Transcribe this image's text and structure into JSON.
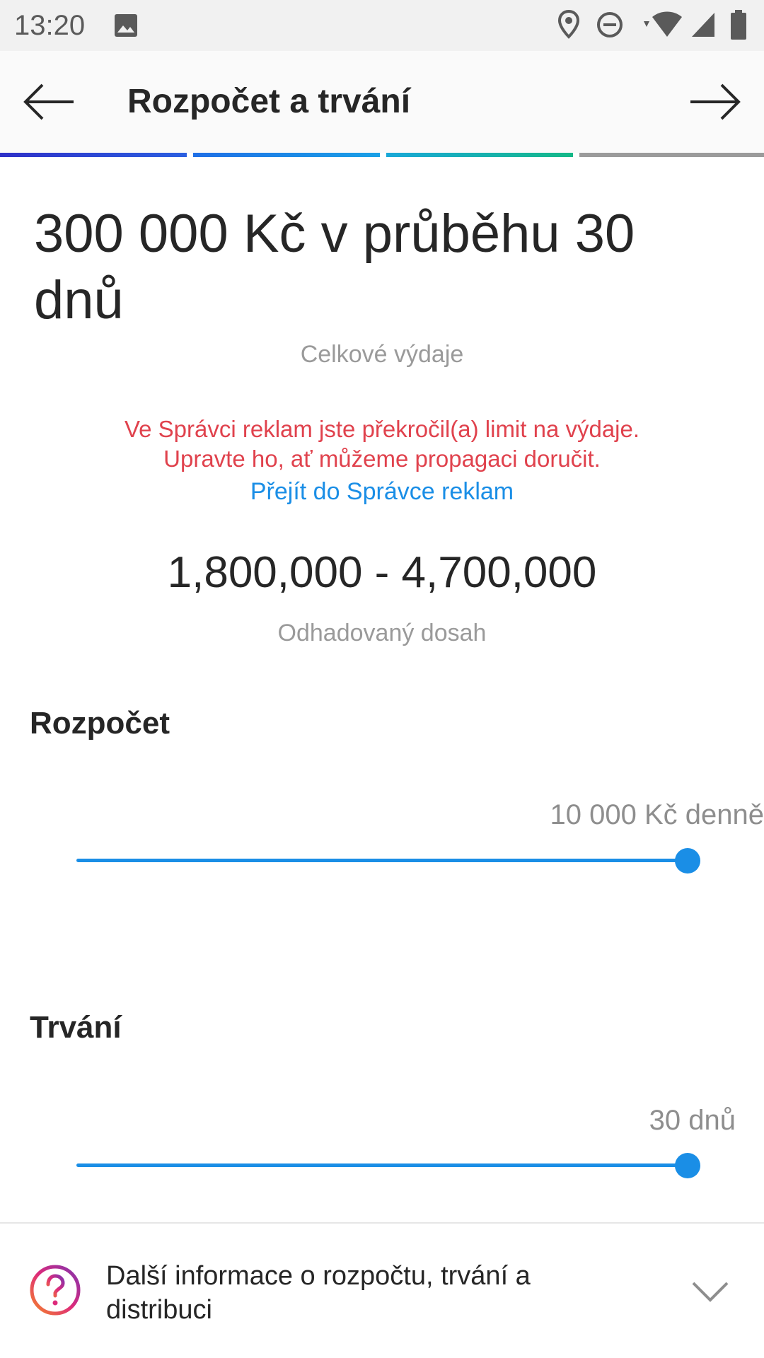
{
  "status_bar": {
    "time": "13:20",
    "icons": [
      "image-icon",
      "location-icon",
      "do-not-disturb-icon",
      "wifi-icon",
      "signal-icon",
      "battery-icon"
    ]
  },
  "app_bar": {
    "title": "Rozpočet a trvání",
    "back_icon": "arrow-left-icon",
    "next_icon": "arrow-right-icon"
  },
  "progress_steps": {
    "total": 4,
    "completed": 3,
    "colors": [
      "#2b3fd6",
      "#1a7fe6",
      "#14b3b0",
      "#9b9b9b"
    ]
  },
  "summary": {
    "headline": "300 000 Kč v průběhu 30 dnů",
    "headline_caption": "Celkové výdaje",
    "warning_line1": "Ve Správci reklam jste překročil(a) limit na výdaje.",
    "warning_line2": "Upravte ho, ať můžeme propagaci doručit.",
    "warning_link": "Přejít do Správce reklam",
    "reach": "1,800,000 - 4,700,000",
    "reach_caption": "Odhadovaný dosah"
  },
  "budget": {
    "label": "Rozpočet",
    "value_text": "10 000 Kč denně",
    "slider_fraction": 1.0
  },
  "duration": {
    "label": "Trvání",
    "value_text": "30 dnů",
    "slider_fraction": 1.0
  },
  "footer": {
    "icon": "help-circle-icon",
    "text": "Další informace o rozpočtu, trvání a distribuci",
    "chevron_icon": "chevron-down-icon"
  },
  "colors": {
    "accent": "#1a8ee6",
    "warning": "#e0424d",
    "text_primary": "#262626",
    "text_secondary": "#9a9a9a"
  }
}
